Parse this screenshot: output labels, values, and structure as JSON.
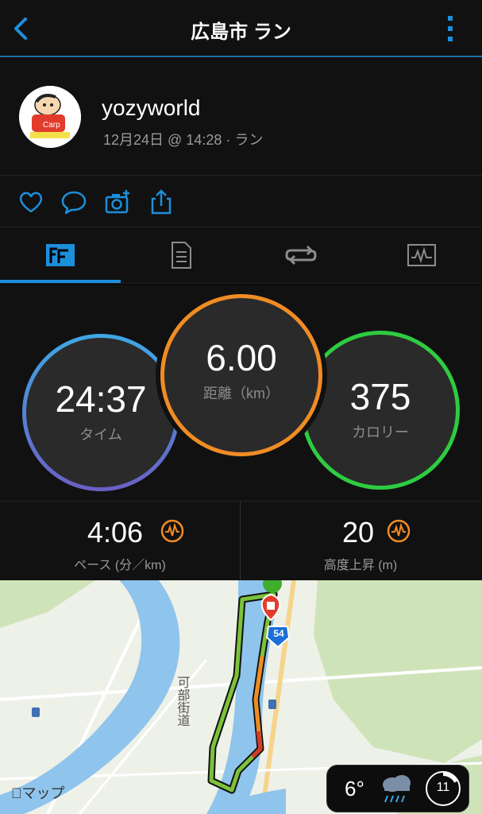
{
  "header": {
    "title": "広島市 ラン",
    "back_icon": "chevron-left-icon",
    "more_icon": "vertical-ellipsis-icon",
    "accent": "#1c8fdb"
  },
  "profile": {
    "username": "yozyworld",
    "meta": "12月24日 @ 14:28 · ラン",
    "avatar_icon": "avatar-cartoon"
  },
  "actions": {
    "icons": [
      "heart-icon",
      "comment-icon",
      "camera-add-icon",
      "share-icon"
    ]
  },
  "tabs": [
    {
      "icon": "overview-icon",
      "active": true
    },
    {
      "icon": "details-icon",
      "active": false
    },
    {
      "icon": "laps-icon",
      "active": false
    },
    {
      "icon": "chart-icon",
      "active": false
    }
  ],
  "stats": {
    "time": {
      "value": "24:37",
      "label": "タイム",
      "color": "#6b5fc4"
    },
    "distance": {
      "value": "6.00",
      "label": "距離（km）",
      "color": "#f08c24"
    },
    "calories": {
      "value": "375",
      "label": "カロリー",
      "color": "#2ecc40"
    }
  },
  "metrics": {
    "pace": {
      "value": "4:06",
      "label": "ペース (分／km)",
      "icon": "chart-pulse-icon"
    },
    "elevation": {
      "value": "20",
      "label": "高度上昇 (m)",
      "icon": "chart-pulse-icon"
    }
  },
  "map": {
    "attribution": "マップ",
    "road_label": "可部街道",
    "route_number": "54",
    "weather": {
      "temp": "6°",
      "icon": "rain-cloud-icon",
      "wind_speed": "11"
    }
  }
}
